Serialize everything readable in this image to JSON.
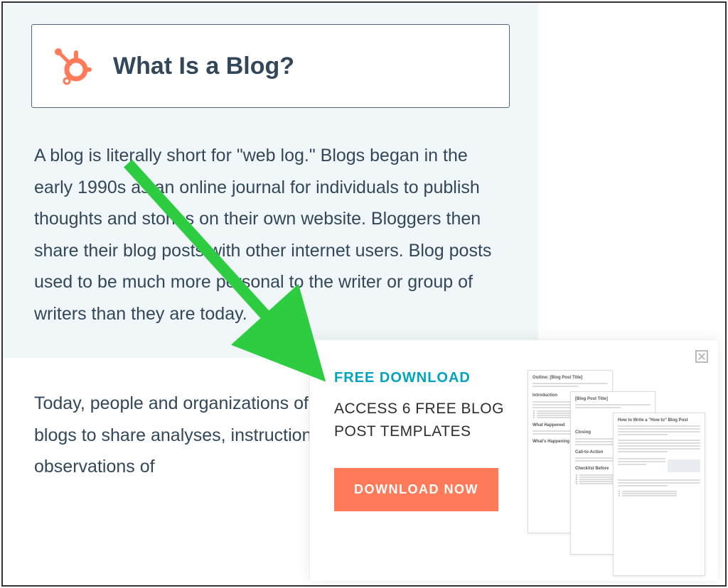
{
  "heading": {
    "title": "What Is a Blog?"
  },
  "paragraphs": {
    "p1": "A blog is literally short for \"web log.\" Blogs began in the early 1990s as an online journal for individuals to publish thoughts and stories on their own website. Bloggers then share their blog posts with other internet users. Blog posts used to be much more personal to the writer or group of writers than they are today.",
    "p2": "Today, people and organizations of all walks of life manage blogs to share analyses, instruction, criticisms, and other observations of"
  },
  "popup": {
    "eyebrow": "FREE DOWNLOAD",
    "headline": "ACCESS 6 FREE BLOG POST TEMPLATES",
    "cta": "DOWNLOAD NOW",
    "thumbs": {
      "t1_title": "Outline: [Blog Post Title]",
      "t2_title": "[Blog Post Title]",
      "t3_title": "How to Write a \"How to\" Blog Post"
    }
  },
  "colors": {
    "accent": "#ff7a59",
    "teal": "#00a4bd",
    "text": "#33475b",
    "arrow": "#2ecc40"
  }
}
